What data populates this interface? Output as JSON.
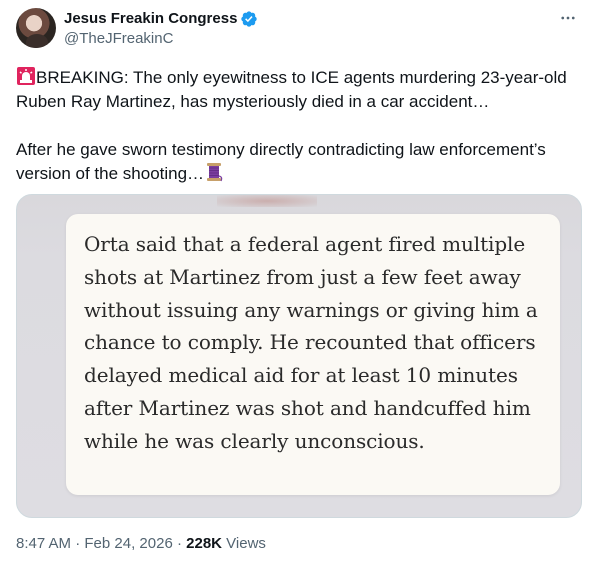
{
  "author": {
    "name": "Jesus Freakin Congress",
    "handle": "@TheJFreakinC",
    "verified_icon": "verified-badge-icon",
    "verified_color": "#1d9bf0"
  },
  "tweet": {
    "paragraph1": "BREAKING: The only eyewitness to ICE agents murdering 23-year-old Ruben Ray Martinez, has mysteriously died in a car accident…",
    "paragraph2": "After he gave sworn testimony directly contradicting law enforcement’s version of the shooting…",
    "lead_emoji": "rotating-light-icon",
    "trail_emoji": "thread-spool-icon"
  },
  "media": {
    "quote_text": "Orta said that a federal agent fired multiple shots at Martinez from just a few feet away without issuing any warnings or giving him a chance to comply. He recounted that officers delayed medical aid for at least 10 minutes after Martinez was shot and handcuffed him while he was clearly unconscious."
  },
  "meta": {
    "time": "8:47 AM",
    "separator": "·",
    "date": "Feb 24, 2026",
    "views_count": "228K",
    "views_label": "Views"
  },
  "colors": {
    "text_primary": "#0f1419",
    "text_secondary": "#536471",
    "media_border": "#cfd9de"
  }
}
